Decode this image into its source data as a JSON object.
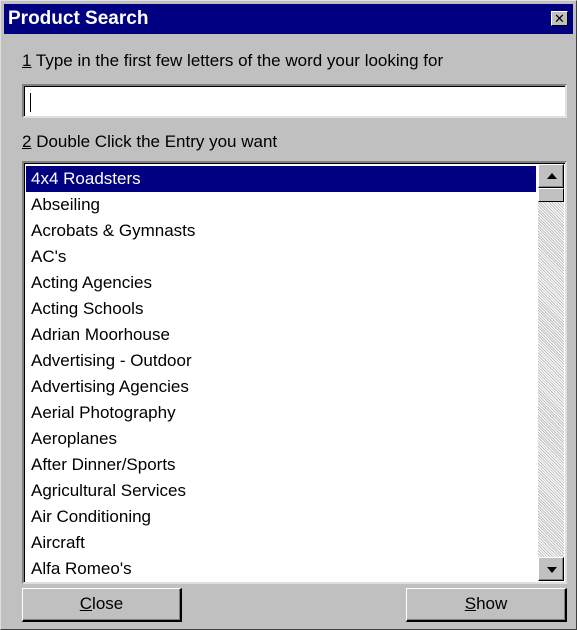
{
  "window": {
    "title": "Product Search",
    "close_glyph": "✕"
  },
  "step1": {
    "number": "1",
    "text": " Type in the first few letters of the word your looking for"
  },
  "search": {
    "value": ""
  },
  "step2": {
    "number": "2",
    "text": " Double Click the Entry you want"
  },
  "list": {
    "selected_index": 0,
    "items": [
      "4x4 Roadsters",
      "Abseiling",
      "Acrobats & Gymnasts",
      "AC's",
      "Acting Agencies",
      "Acting Schools",
      "Adrian Moorhouse",
      "Advertising - Outdoor",
      "Advertising Agencies",
      "Aerial Photography",
      "Aeroplanes",
      "After Dinner/Sports",
      "Agricultural Services",
      "Air Conditioning",
      "Aircraft",
      "Alfa Romeo's"
    ]
  },
  "buttons": {
    "close_mnemonic": "C",
    "close_rest": "lose",
    "show_mnemonic": "S",
    "show_rest": "how"
  },
  "colors": {
    "titlebar": "#000080",
    "selection": "#000080",
    "face": "#c0c0c0"
  },
  "icons": {
    "close": "close-icon",
    "scroll_up": "arrow-up-icon",
    "scroll_down": "arrow-down-icon"
  }
}
